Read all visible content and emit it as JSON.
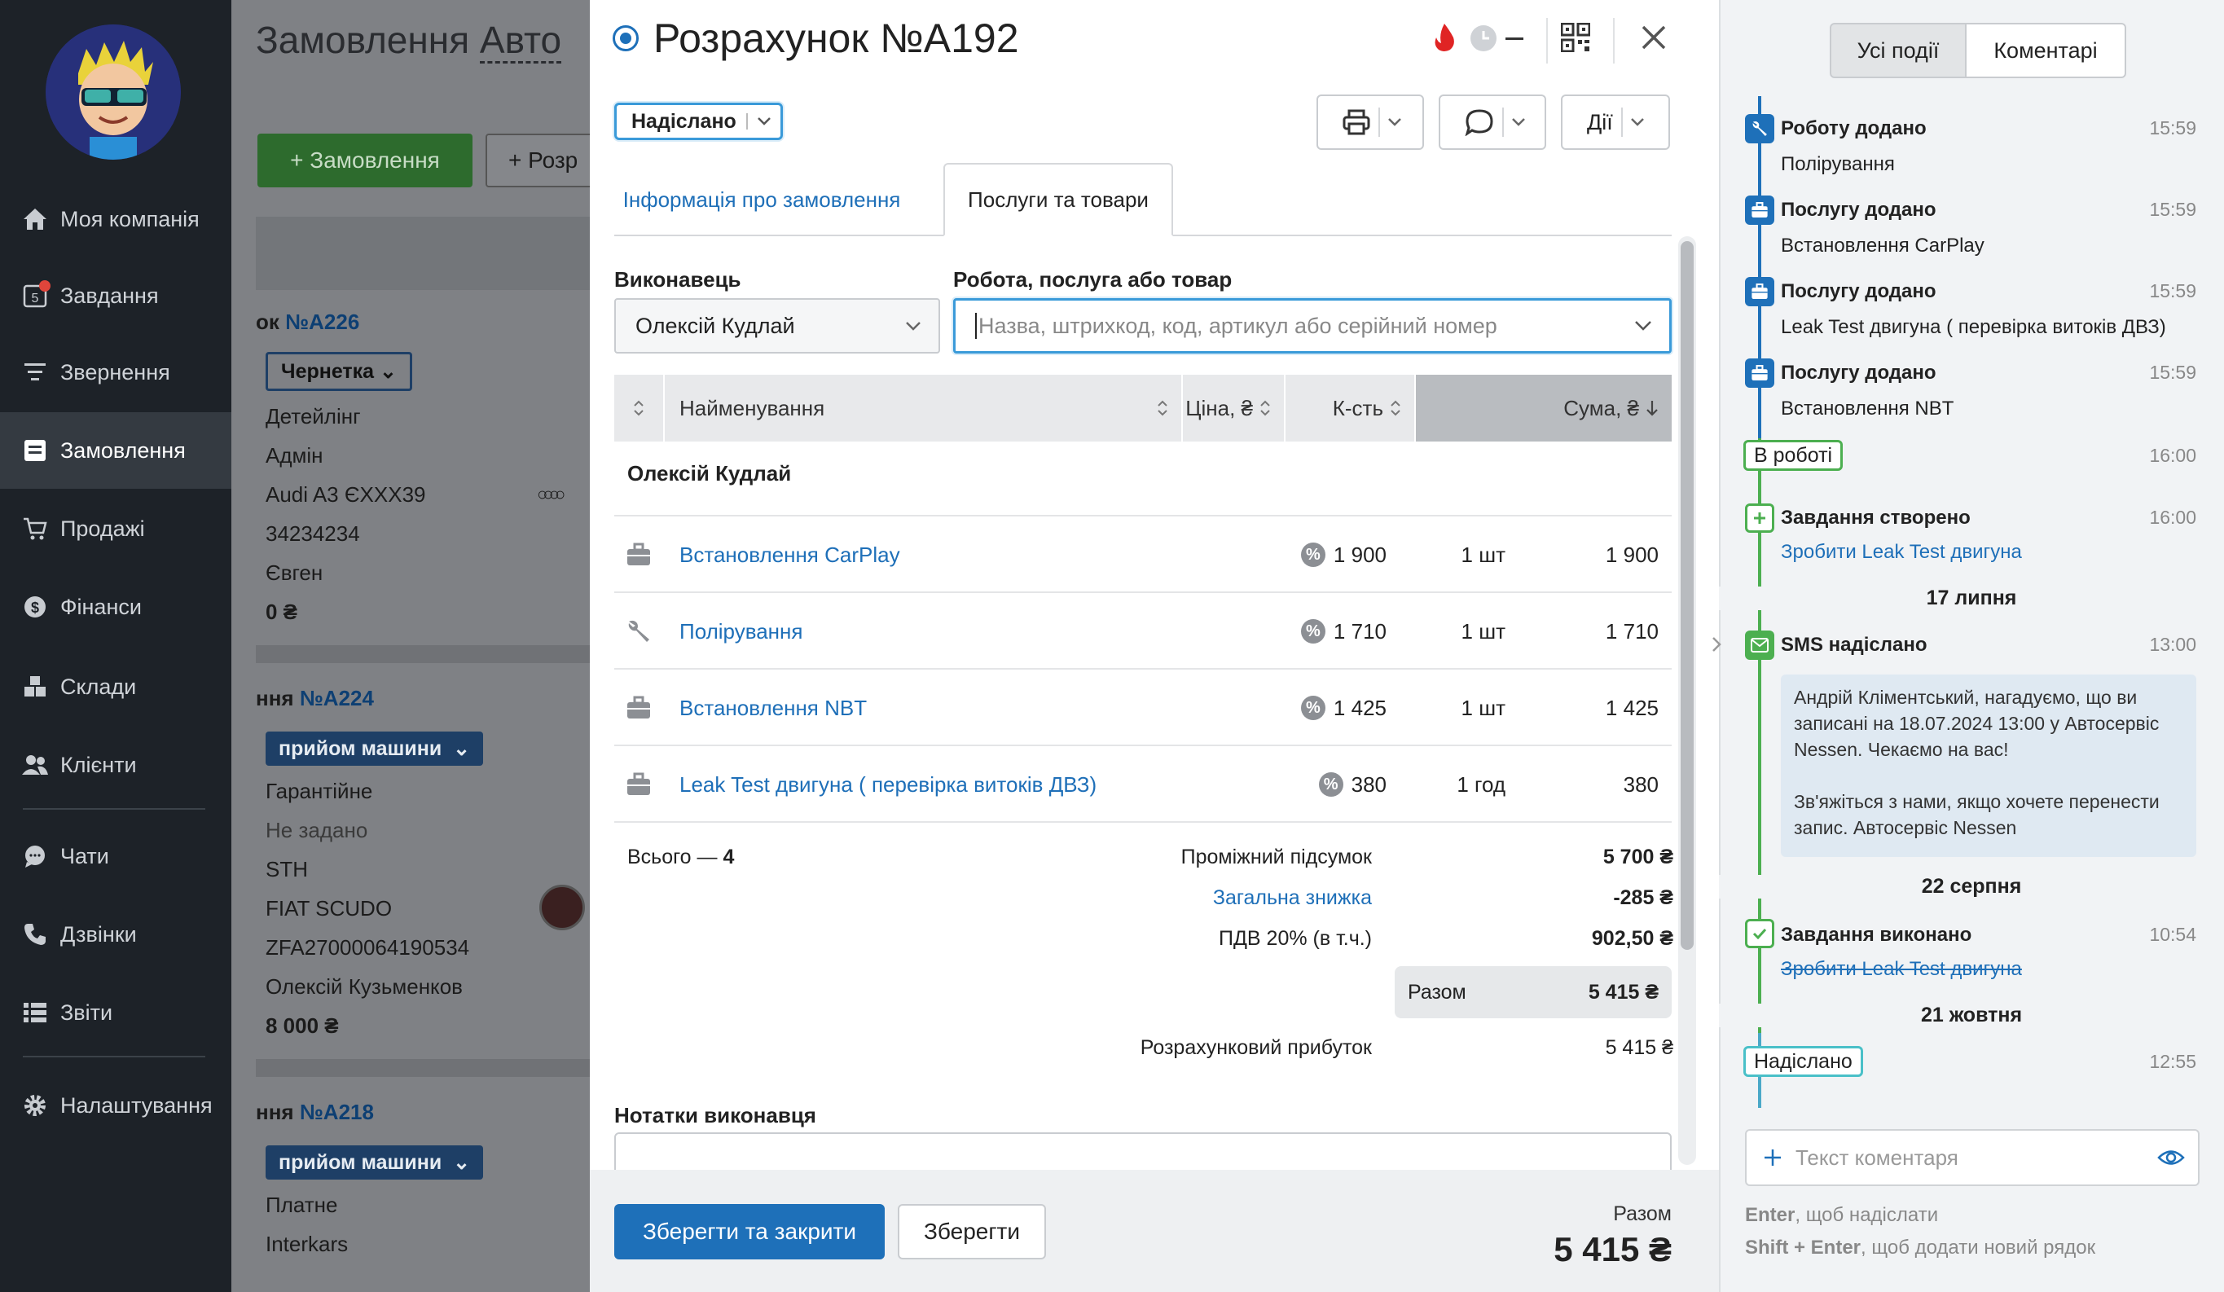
{
  "nav": {
    "items": [
      {
        "label": "Моя компанія"
      },
      {
        "label": "Завдання",
        "count": "5"
      },
      {
        "label": "Звернення"
      },
      {
        "label": "Замовлення"
      },
      {
        "label": "Продажі"
      },
      {
        "label": "Фінанси"
      },
      {
        "label": "Склади"
      },
      {
        "label": "Клієнти"
      },
      {
        "label": "Чати"
      },
      {
        "label": "Дзвінки"
      },
      {
        "label": "Звіти"
      },
      {
        "label": "Налаштування"
      }
    ]
  },
  "background": {
    "page_title": "Замовлення",
    "page_title_tail": "Авто",
    "add_order": "+ Замовлення",
    "add_calc": "+ Розр",
    "orders": [
      {
        "prefix": "ок",
        "number": "№A226",
        "status": "Чернетка",
        "lines": [
          "Детейлінг",
          "Адмін",
          "Audi A3 ЄХХХ39",
          "34234234",
          "Євген",
          "0 ₴"
        ]
      },
      {
        "prefix": "ння",
        "number": "№A224",
        "status": "прийом машини",
        "lines": [
          "Гарантійне",
          "Не задано",
          "STH",
          "FIAT SCUDO",
          "ZFA27000064190534",
          "Олексій Кузьменков",
          "8 000 ₴"
        ]
      },
      {
        "prefix": "ння",
        "number": "№A218",
        "status": "прийом машини",
        "lines": [
          "Платне",
          "Interkars"
        ]
      }
    ]
  },
  "modal": {
    "title": "Розрахунок №A192",
    "status": "Надіслано",
    "actions_label": "Дії",
    "tabs": [
      "Інформація про замовлення",
      "Послуги та товари"
    ],
    "executor_label": "Виконавець",
    "executor_value": "Олексій Кудлай",
    "search_label": "Робота, послуга або товар",
    "search_placeholder": "Назва, штрихкод, код, артикул або серійний номер",
    "columns": {
      "name": "Найменування",
      "price": "Ціна, ₴",
      "qty": "К-сть",
      "sum": "Сума, ₴"
    },
    "group": "Олексій Кудлай",
    "rows": [
      {
        "icon": "briefcase-icon",
        "name": "Встановлення CarPlay",
        "price": "1 900",
        "qty": "1 шт",
        "sum": "1 900"
      },
      {
        "icon": "wrench-icon",
        "name": "Полірування",
        "price": "1 710",
        "qty": "1 шт",
        "sum": "1 710"
      },
      {
        "icon": "briefcase-icon",
        "name": "Встановлення NBT",
        "price": "1 425",
        "qty": "1 шт",
        "sum": "1 425"
      },
      {
        "icon": "briefcase-icon",
        "name": "Leak Test двигуна ( перевірка витоків ДВЗ)",
        "price": "380",
        "qty": "1 год",
        "sum": "380"
      }
    ],
    "totals": {
      "count_label": "Всього — ",
      "count": "4",
      "subtotal_label": "Проміжний підсумок",
      "subtotal": "5 700 ₴",
      "discount_label": "Загальна знижка",
      "discount": "-285 ₴",
      "vat_label": "ПДВ 20% (в т.ч.)",
      "vat": "902,50 ₴",
      "total_label": "Разом",
      "total": "5 415 ₴",
      "profit_label": "Розрахунковий прибуток",
      "profit": "5 415 ₴"
    },
    "notes_label": "Нотатки виконавця",
    "footer": {
      "save_close": "Зберегти та закрити",
      "save": "Зберегти",
      "total_label": "Разом",
      "total": "5 415 ₴"
    }
  },
  "panel": {
    "tabs": [
      "Усі події",
      "Коментарі"
    ],
    "events": [
      {
        "title": "Роботу додано",
        "sub": "Полірування",
        "time": "15:59"
      },
      {
        "title": "Послугу додано",
        "sub": "Встановлення CarPlay",
        "time": "15:59"
      },
      {
        "title": "Послугу додано",
        "sub": "Leak Test двигуна ( перевірка витоків ДВЗ)",
        "time": "15:59"
      },
      {
        "title": "Послугу додано",
        "sub": "Встановлення NBT",
        "time": "15:59"
      }
    ],
    "status1": {
      "label": "В роботі",
      "time": "16:00"
    },
    "task_created": {
      "title": "Завдання створено",
      "link": "Зробити Leak Test двигуна",
      "time": "16:00"
    },
    "date1": "17 липня",
    "sms": {
      "title": "SMS надіслано",
      "time": "13:00",
      "message1": "Андрій Кліментський, нагадуємо, що ви записані на 18.07.2024 13:00 у Автосервіс Nessen. Чекаємо на вас!",
      "message2": "Зв'яжіться з нами, якщо хочете перенести запис. Автосервіс Nessen"
    },
    "date2": "22 серпня",
    "task_done": {
      "title": "Завдання виконано",
      "link": "Зробити Leak Test двигуна",
      "time": "10:54"
    },
    "date3": "21 жовтня",
    "status2": {
      "label": "Надіслано",
      "time": "12:55"
    },
    "comment_placeholder": "Текст коментаря",
    "hint1_key": "Enter",
    "hint1": ", щоб надіслати",
    "hint2_key": "Shift + Enter",
    "hint2": ", щоб додати новий рядок"
  },
  "colors": {
    "accent": "#1e70b9",
    "green": "#4caf50",
    "nav_bg": "#1d2228",
    "blue_icon": "#1e70b9"
  }
}
